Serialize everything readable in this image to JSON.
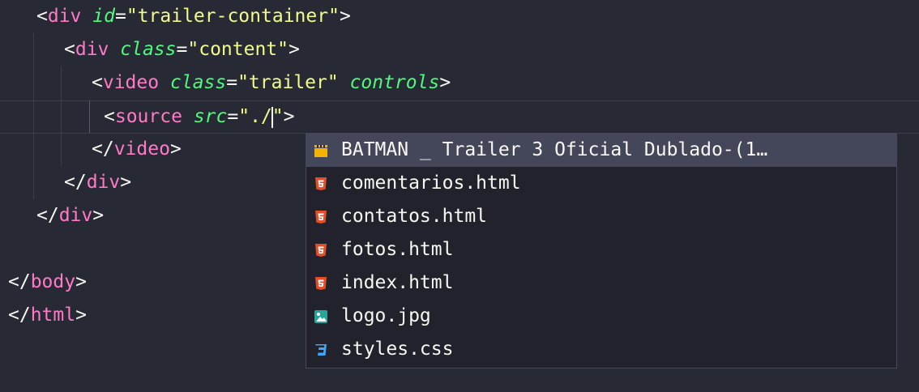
{
  "editor": {
    "lines": [
      {
        "lt": "<",
        "tag": "div",
        "sp": " ",
        "attr": "id",
        "eq": "=",
        "str": "\"trailer-container\"",
        "gt": ">"
      },
      {
        "lt": "<",
        "tag": "div",
        "sp": " ",
        "attr": "class",
        "eq": "=",
        "str": "\"content\"",
        "gt": ">"
      },
      {
        "lt": "<",
        "tag": "video",
        "sp": " ",
        "attr": "class",
        "eq": "=",
        "str": "\"trailer\"",
        "sp2": " ",
        "attr2": "controls",
        "gt": ">"
      },
      {
        "lt": "<",
        "tag": "source",
        "sp": " ",
        "attr": "src",
        "eq": "=",
        "str_before": "\"./",
        "str_after": "\"",
        "gt": ">"
      },
      {
        "lt": "</",
        "tag": "video",
        "gt": ">"
      },
      {
        "lt": "</",
        "tag": "div",
        "gt": ">"
      },
      {
        "lt": "</",
        "tag": "div",
        "gt": ">"
      },
      {
        "lt": "</",
        "tag": "body",
        "gt": ">"
      },
      {
        "lt": "</",
        "tag": "html",
        "gt": ">"
      }
    ]
  },
  "suggestions": {
    "items": [
      {
        "label": "BATMAN _ Trailer 3 Oficial Dublado-(1…",
        "icon": "video-file-icon",
        "color": "#f5b300"
      },
      {
        "label": "comentarios.html",
        "icon": "html-file-icon",
        "color": "#e44d26"
      },
      {
        "label": "contatos.html",
        "icon": "html-file-icon",
        "color": "#e44d26"
      },
      {
        "label": "fotos.html",
        "icon": "html-file-icon",
        "color": "#e44d26"
      },
      {
        "label": "index.html",
        "icon": "html-file-icon",
        "color": "#e44d26"
      },
      {
        "label": "logo.jpg",
        "icon": "image-file-icon",
        "color": "#26a69a"
      },
      {
        "label": "styles.css",
        "icon": "css-file-icon",
        "color": "#42a5f5"
      }
    ]
  }
}
